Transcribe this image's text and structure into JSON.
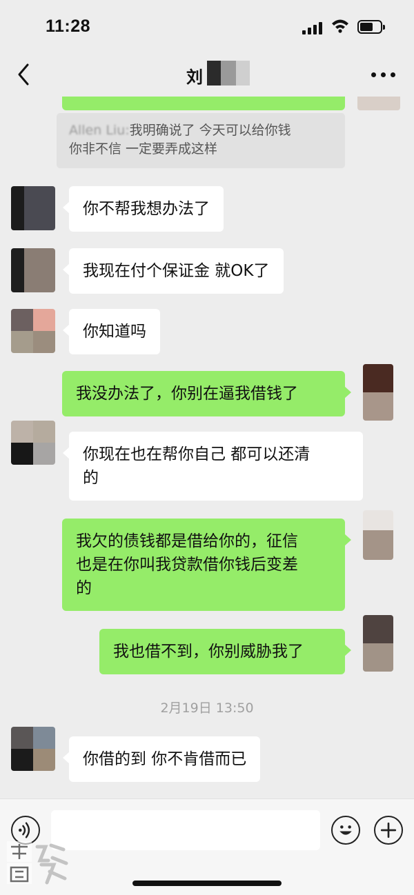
{
  "status_bar": {
    "time": "11:28",
    "icons": [
      "cellular-signal-icon",
      "wifi-icon",
      "battery-icon"
    ]
  },
  "header": {
    "title": "刘",
    "back_icon": "chevron-left-icon",
    "more_icon": "more-dots-icon"
  },
  "quote": {
    "sender": "Allen Liu:",
    "line1": "我明确说了 今天可以给你钱",
    "line2": "你非不信 一定要弄成这样"
  },
  "messages": [
    {
      "side": "in",
      "text": "你不帮我想办法了"
    },
    {
      "side": "in",
      "text": "我现在付个保证金 就OK了"
    },
    {
      "side": "in",
      "text": "你知道吗"
    },
    {
      "side": "out",
      "text": "我没办法了，你别在逼我借钱了"
    },
    {
      "side": "in",
      "line1": "你现在也在帮你自己 都可以还清",
      "line2": "的"
    },
    {
      "side": "out",
      "line1": "我欠的债钱都是借给你的，征信",
      "line2": "也是在你叫我贷款借你钱后变差",
      "line3": "的"
    },
    {
      "side": "out",
      "text": "我也借不到，你别威胁我了"
    },
    {
      "side": "in",
      "text": "你借的到 你不肯借而已"
    }
  ],
  "timestamp": "2月19日 13:50",
  "input_bar": {
    "voice_icon": "voice-input-icon",
    "emoji_icon": "emoji-icon",
    "plus_icon": "plus-circle-icon",
    "input_value": ""
  },
  "colors": {
    "background": "#ededed",
    "incoming_bubble": "#ffffff",
    "outgoing_bubble": "#95ec69"
  }
}
